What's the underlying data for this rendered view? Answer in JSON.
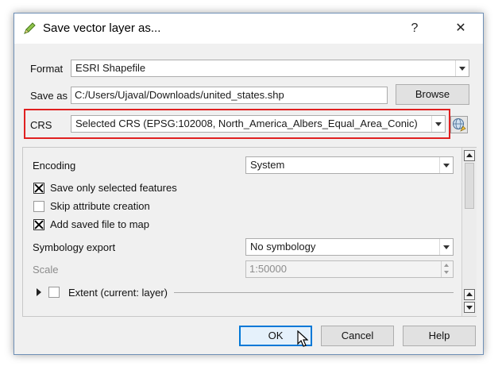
{
  "window": {
    "title": "Save vector layer as...",
    "help_glyph": "?",
    "close_glyph": "✕"
  },
  "form": {
    "format_label": "Format",
    "format_value": "ESRI Shapefile",
    "saveas_label": "Save as",
    "saveas_value": "C:/Users/Ujaval/Downloads/united_states.shp",
    "browse_label": "Browse",
    "crs_label": "CRS",
    "crs_value": "Selected CRS (EPSG:102008, North_America_Albers_Equal_Area_Conic)"
  },
  "options": {
    "encoding_label": "Encoding",
    "encoding_value": "System",
    "save_selected_label": "Save only selected features",
    "save_selected_checked": true,
    "skip_attr_label": "Skip attribute creation",
    "skip_attr_checked": false,
    "add_saved_label": "Add saved file to map",
    "add_saved_checked": true,
    "symbology_label": "Symbology export",
    "symbology_value": "No symbology",
    "scale_label": "Scale",
    "scale_value": "1:50000",
    "extent_label": "Extent (current: layer)"
  },
  "buttons": {
    "ok": "OK",
    "cancel": "Cancel",
    "help": "Help"
  },
  "colors": {
    "highlight": "#e02020",
    "accent": "#0078d7"
  }
}
